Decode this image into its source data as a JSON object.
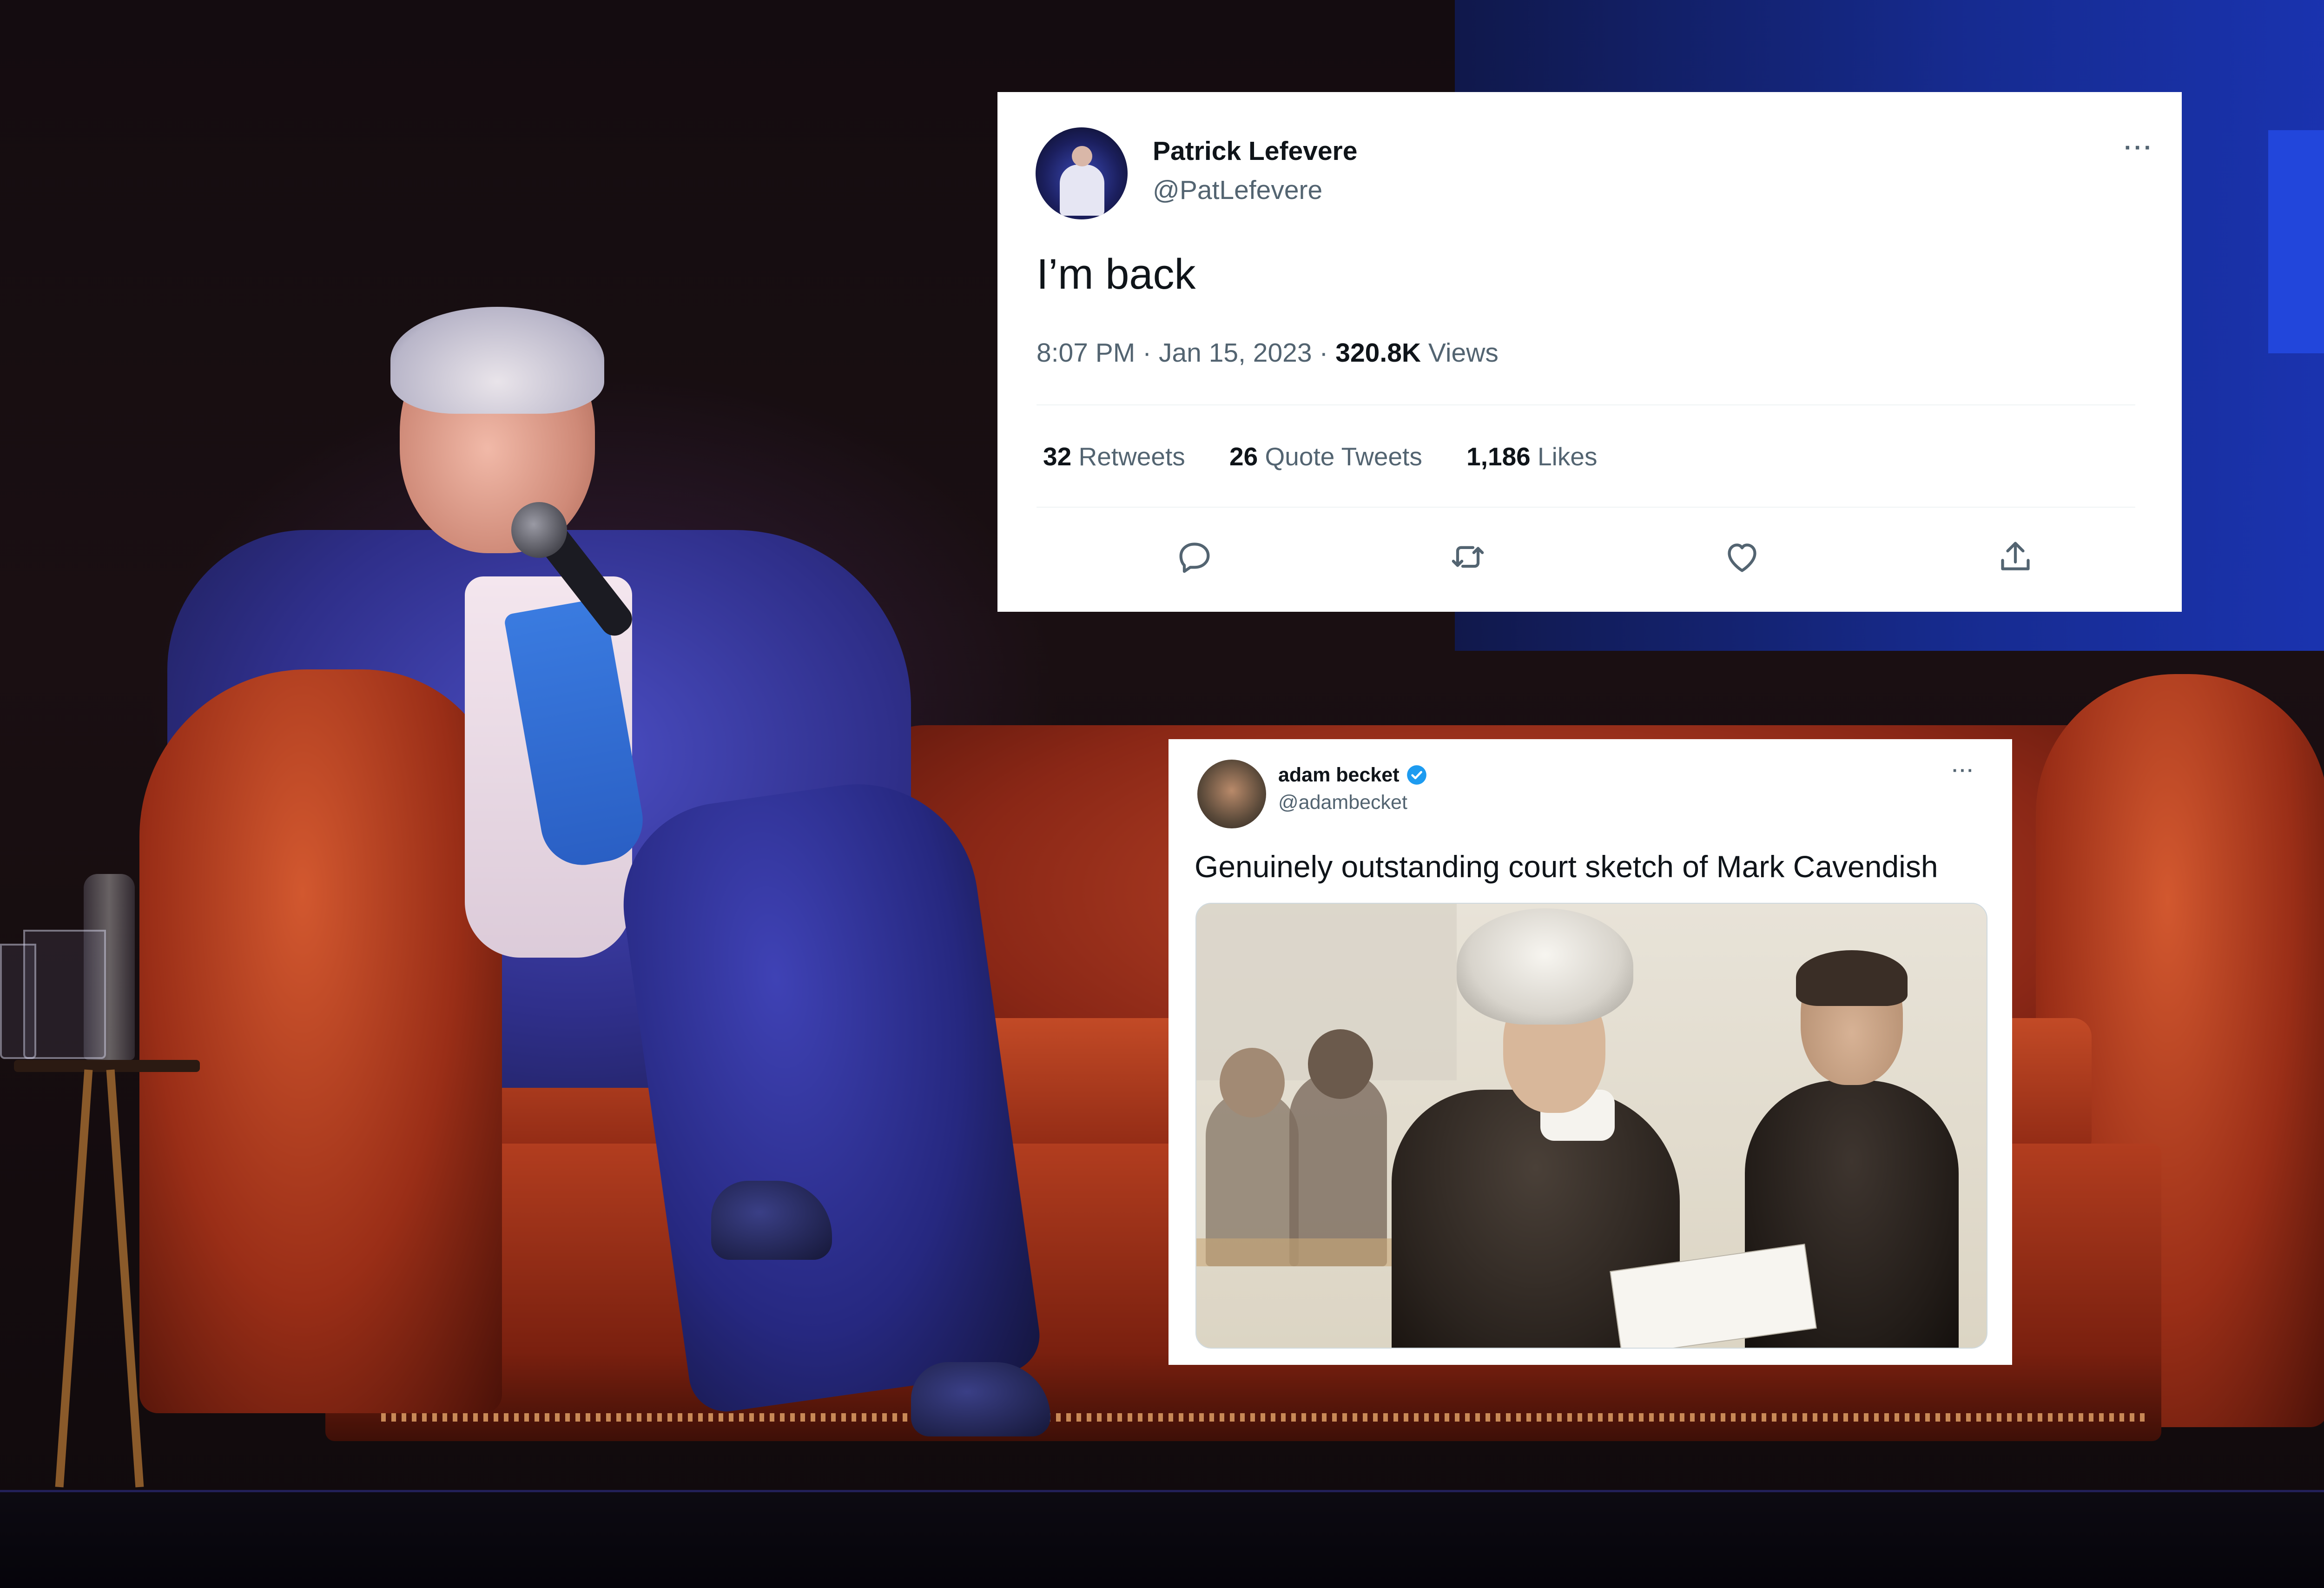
{
  "tweet_primary": {
    "author_name": "Patrick Lefevere",
    "author_handle": "@PatLefevere",
    "more_label": "···",
    "text": "I’m back",
    "time": "8:07 PM",
    "date": "Jan 15, 2023",
    "views_count": "320.8K",
    "views_label": "Views",
    "retweets_count": "32",
    "retweets_label": "Retweets",
    "quote_tweets_count": "26",
    "quote_tweets_label": "Quote Tweets",
    "likes_count": "1,186",
    "likes_label": "Likes",
    "actions": [
      "reply-icon",
      "retweet-icon",
      "like-icon",
      "share-icon"
    ]
  },
  "tweet_secondary": {
    "author_name": "adam becket",
    "author_handle": "@adambecket",
    "verified": true,
    "more_label": "···",
    "text": "Genuinely outstanding court sketch of Mark Cavendish",
    "media": "court-sketch-image"
  },
  "colors": {
    "text_primary": "#0f1419",
    "text_secondary": "#536471",
    "verified_blue": "#1d9bf0",
    "card_bg": "#ffffff"
  }
}
